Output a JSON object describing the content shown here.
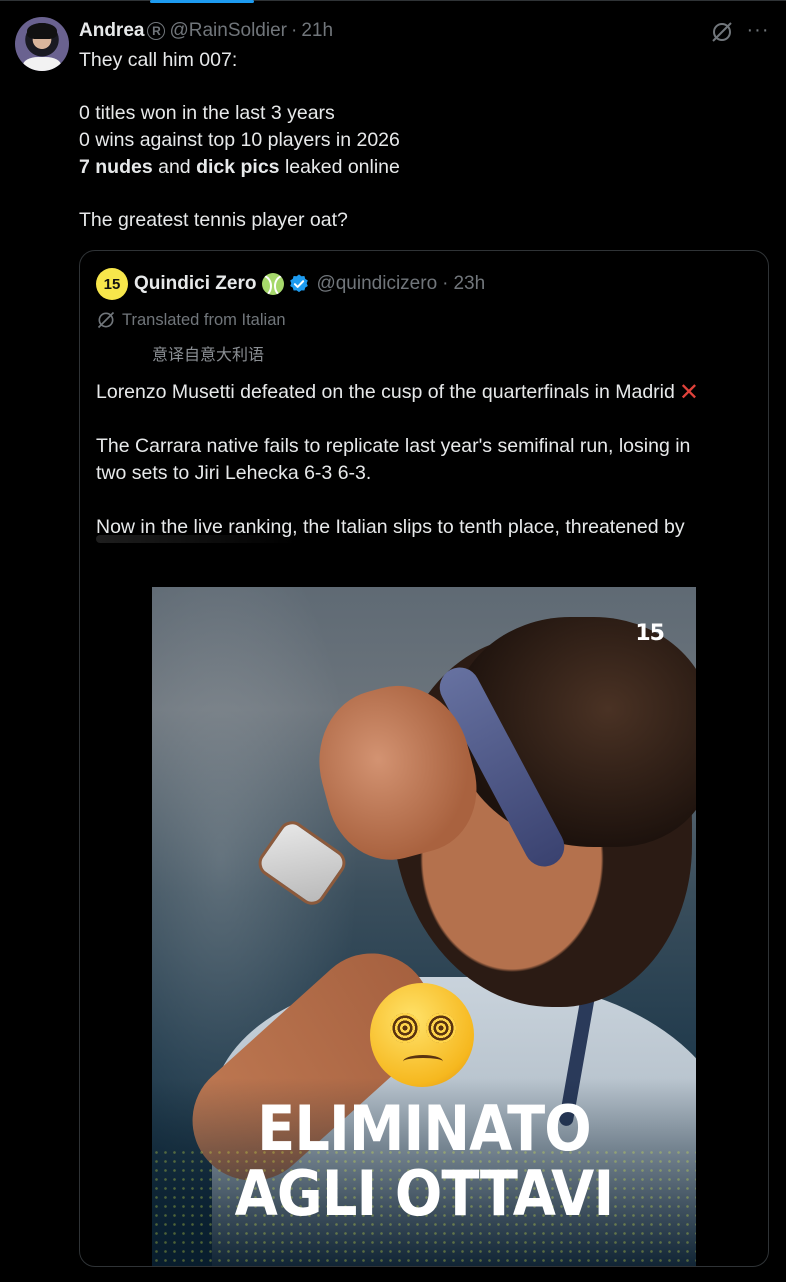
{
  "post": {
    "author": {
      "display_name": "Andrea",
      "badge": "R",
      "handle": "@RainSoldier",
      "separator": "·",
      "time": "21h"
    },
    "body": {
      "line1": "They call him 007:",
      "line2": "0 titles won in the last 3 years",
      "line3": "0 wins against top 10 players in 2026",
      "line4_bold1": "7 nudes",
      "line4_mid": " and ",
      "line4_bold2": "dick pics",
      "line4_end": " leaked online",
      "line5": "The greatest tennis player oat?"
    },
    "icons": {
      "grok": "grok-icon",
      "more": "more-icon",
      "more_glyph": "···"
    }
  },
  "quoted_post": {
    "logo_text": "15",
    "display_name": "Quindici Zero",
    "handle": "@quindicizero",
    "separator": "·",
    "time": "23h",
    "translated_label": "Translated from Italian",
    "chinese_translation": "意译自意大利语",
    "text": {
      "p1": "Lorenzo Musetti defeated on the cusp of the quarterfinals in Madrid",
      "p2a": "The Carrara native fails to replicate last year's semifinal run, losing in",
      "p2b": "two sets to Jiri Lehecka 6-3 6-3.",
      "p3": "Now in the live ranking, the Italian slips to tenth place, threatened by"
    },
    "media": {
      "logo": "15",
      "headline_line1": "ELIMINATO",
      "headline_line2": "AGLI OTTAVI",
      "emoji": "dizzy-face"
    }
  },
  "colors": {
    "background": "#000000",
    "text": "#e7e9ea",
    "muted": "#71767b",
    "accent": "#1d9bf0",
    "border": "#2f3336",
    "logo_yellow": "#f7e64b",
    "cross_red": "#e0423b"
  }
}
